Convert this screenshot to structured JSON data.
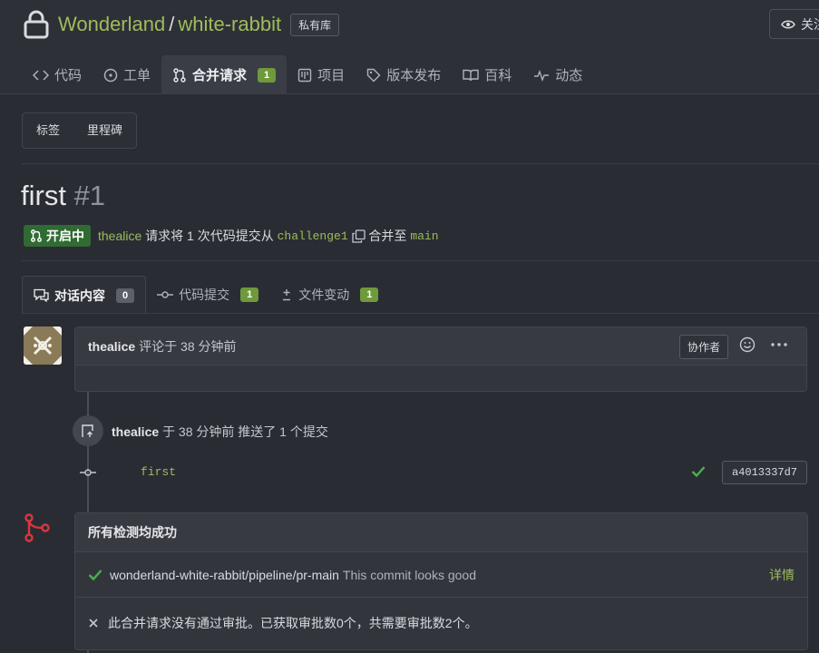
{
  "repo": {
    "owner": "Wonderland",
    "separator": "/",
    "name": "white-rabbit",
    "badge": "私有库",
    "watch_label": "关注"
  },
  "tabs": [
    {
      "label": "代码",
      "icon": "code-icon"
    },
    {
      "label": "工单",
      "icon": "issue-icon"
    },
    {
      "label": "合并请求",
      "icon": "pull-request-icon",
      "count": "1",
      "active": true
    },
    {
      "label": "项目",
      "icon": "project-icon"
    },
    {
      "label": "版本发布",
      "icon": "tag-icon"
    },
    {
      "label": "百科",
      "icon": "book-icon"
    },
    {
      "label": "动态",
      "icon": "pulse-icon"
    }
  ],
  "filters": {
    "labels": "标签",
    "milestones": "里程碑"
  },
  "pr": {
    "title": "first",
    "number": "#1",
    "status": "开启中",
    "author": "thealice",
    "request_text": "请求将 1 次代码提交从",
    "head_branch": "challenge1",
    "merge_into_text": "合并至",
    "base_branch": "main"
  },
  "subtabs": [
    {
      "label": "对话内容",
      "count": "0",
      "icon": "comments-icon",
      "active": true
    },
    {
      "label": "代码提交",
      "count": "1",
      "icon": "commit-icon"
    },
    {
      "label": "文件变动",
      "count": "1",
      "icon": "diff-icon"
    }
  ],
  "comment": {
    "author": "thealice",
    "meta": "评论于 38 分钟前",
    "role": "协作者"
  },
  "push_event": {
    "author": "thealice",
    "text": "于 38 分钟前 推送了 1 个提交"
  },
  "commit": {
    "message": "first",
    "sha": "a4013337d7"
  },
  "checks": {
    "title": "所有检测均成功",
    "context": "wonderland-white-rabbit/pipeline/pr-main",
    "description": "This commit looks good",
    "details": "详情",
    "approval": "此合并请求没有通过审批。已获取审批数0个，共需要审批数2个。"
  },
  "colors": {
    "accent_green": "#9dbd5b",
    "open_badge": "#2f6b33",
    "count_badge": "#6e9a3b",
    "merge_red": "#d9363e"
  }
}
